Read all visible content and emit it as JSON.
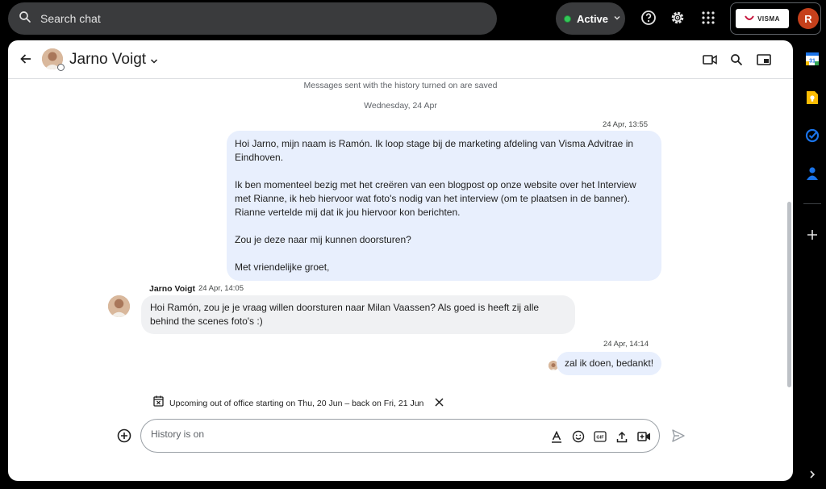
{
  "topbar": {
    "search_label": "Search chat",
    "status_label": "Active",
    "org_logo_text": "VISMA",
    "user_initial": "R"
  },
  "header": {
    "contact_name": "Jarno Voigt"
  },
  "conversation": {
    "history_notice": "Messages sent with the history turned on are saved",
    "date_divider": "Wednesday, 24 Apr",
    "messages": [
      {
        "direction": "outgoing",
        "time": "24 Apr, 13:55",
        "paragraphs": [
          "Hoi Jarno, mijn naam is Ramón. Ik loop stage bij de marketing afdeling van Visma Advitrae in Eindhoven.",
          "Ik ben momenteel bezig met het creëren van een blogpost op onze website over het Interview met Rianne, ik heb hiervoor wat foto's nodig van het interview (om te plaatsen in de banner). Rianne vertelde mij dat ik jou hiervoor kon berichten.",
          "Zou je deze naar mij kunnen doorsturen?",
          "Met vriendelijke groet,"
        ]
      },
      {
        "direction": "incoming",
        "sender": "Jarno Voigt",
        "time": "24 Apr, 14:05",
        "text": "Hoi Ramón, zou je je vraag willen doorsturen naar Milan Vaassen? Als goed is heeft zij alle behind the scenes foto's :)"
      },
      {
        "direction": "outgoing",
        "time": "24 Apr, 14:14",
        "text": "zal ik doen, bedankt!"
      }
    ]
  },
  "out_of_office": {
    "text": "Upcoming out of office starting on Thu, 20 Jun – back on Fri, 21 Jun"
  },
  "composer": {
    "placeholder": "History is on",
    "gif_label": "GIF"
  },
  "colors": {
    "accent": "#1a73e8",
    "active_green": "#34c759",
    "outgoing_bubble": "#e8effd",
    "incoming_bubble": "#f0f1f3",
    "user_avatar": "#c5401b"
  }
}
